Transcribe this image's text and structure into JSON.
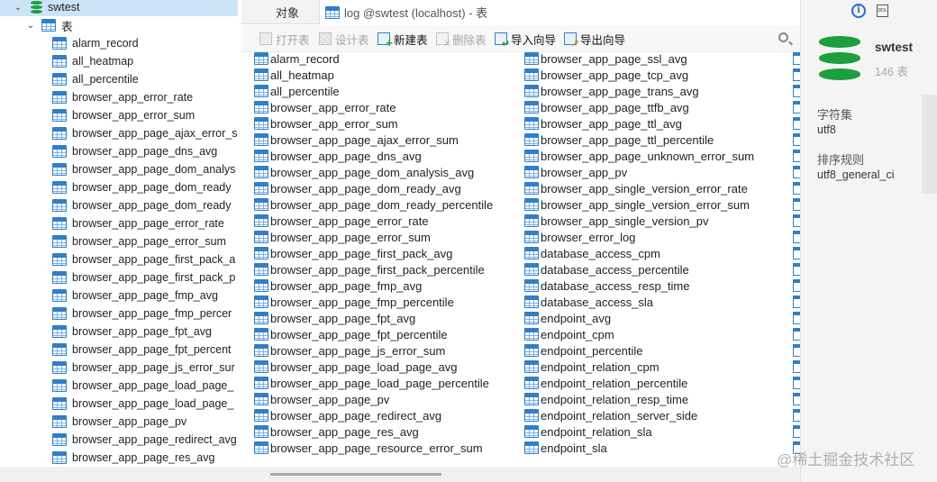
{
  "nav": {
    "database": "swtest",
    "folder": "表",
    "tables": [
      "alarm_record",
      "all_heatmap",
      "all_percentile",
      "browser_app_error_rate",
      "browser_app_error_sum",
      "browser_app_page_ajax_error_s",
      "browser_app_page_dns_avg",
      "browser_app_page_dom_analys",
      "browser_app_page_dom_ready",
      "browser_app_page_dom_ready",
      "browser_app_page_error_rate",
      "browser_app_page_error_sum",
      "browser_app_page_first_pack_a",
      "browser_app_page_first_pack_p",
      "browser_app_page_fmp_avg",
      "browser_app_page_fmp_percer",
      "browser_app_page_fpt_avg",
      "browser_app_page_fpt_percent",
      "browser_app_page_js_error_sur",
      "browser_app_page_load_page_",
      "browser_app_page_load_page_",
      "browser_app_page_pv",
      "browser_app_page_redirect_avg",
      "browser_app_page_res_avg"
    ]
  },
  "tabs": {
    "objects": "对象",
    "log": "log @swtest (localhost) - 表"
  },
  "toolbar": {
    "open": "打开表",
    "design": "设计表",
    "new": "新建表",
    "delete": "删除表",
    "import": "导入向导",
    "export": "导出向导"
  },
  "objects": {
    "col1": [
      "alarm_record",
      "all_heatmap",
      "all_percentile",
      "browser_app_error_rate",
      "browser_app_error_sum",
      "browser_app_page_ajax_error_sum",
      "browser_app_page_dns_avg",
      "browser_app_page_dom_analysis_avg",
      "browser_app_page_dom_ready_avg",
      "browser_app_page_dom_ready_percentile",
      "browser_app_page_error_rate",
      "browser_app_page_error_sum",
      "browser_app_page_first_pack_avg",
      "browser_app_page_first_pack_percentile",
      "browser_app_page_fmp_avg",
      "browser_app_page_fmp_percentile",
      "browser_app_page_fpt_avg",
      "browser_app_page_fpt_percentile",
      "browser_app_page_js_error_sum",
      "browser_app_page_load_page_avg",
      "browser_app_page_load_page_percentile",
      "browser_app_page_pv",
      "browser_app_page_redirect_avg",
      "browser_app_page_res_avg",
      "browser_app_page_resource_error_sum"
    ],
    "col2": [
      "browser_app_page_ssl_avg",
      "browser_app_page_tcp_avg",
      "browser_app_page_trans_avg",
      "browser_app_page_ttfb_avg",
      "browser_app_page_ttl_avg",
      "browser_app_page_ttl_percentile",
      "browser_app_page_unknown_error_sum",
      "browser_app_pv",
      "browser_app_single_version_error_rate",
      "browser_app_single_version_error_sum",
      "browser_app_single_version_pv",
      "browser_error_log",
      "database_access_cpm",
      "database_access_percentile",
      "database_access_resp_time",
      "database_access_sla",
      "endpoint_avg",
      "endpoint_cpm",
      "endpoint_percentile",
      "endpoint_relation_cpm",
      "endpoint_relation_percentile",
      "endpoint_relation_resp_time",
      "endpoint_relation_server_side",
      "endpoint_relation_sla",
      "endpoint_sla"
    ]
  },
  "info": {
    "name": "swtest",
    "count": "146 表",
    "charset_label": "字符集",
    "charset_value": "utf8",
    "collation_label": "排序规则",
    "collation_value": "utf8_general_ci",
    "ddl_icon_text": "DDL"
  },
  "watermark": "@稀土掘金技术社区",
  "colors": {
    "selection": "#cde4f7",
    "db_green": "#1e9e3e",
    "table_blue": "#2f7fc9"
  }
}
